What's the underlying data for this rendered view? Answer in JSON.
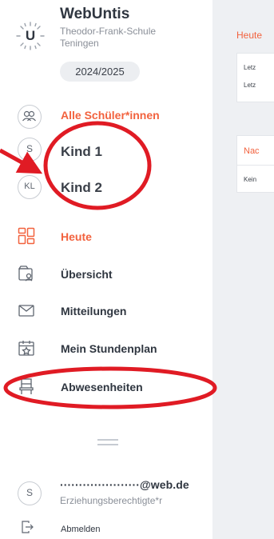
{
  "header": {
    "app_title": "WebUntis",
    "school_name": "Theodor-Frank-Schule",
    "school_city": "Teningen",
    "school_year": "2024/2025",
    "logo_letter": "U",
    "logo_icon": "webuntis-logo"
  },
  "students": {
    "all_label": "Alle Schüler*innen",
    "all_icon": "group-icon",
    "children": [
      {
        "initials": "S",
        "name": "Kind 1"
      },
      {
        "initials": "KL",
        "name": "Kind 2"
      }
    ]
  },
  "nav": [
    {
      "label": "Heute",
      "icon": "dashboard-icon",
      "active": true
    },
    {
      "label": "Übersicht",
      "icon": "overview-icon",
      "active": false
    },
    {
      "label": "Mitteilungen",
      "icon": "envelope-icon",
      "active": false
    },
    {
      "label": "Mein Stundenplan",
      "icon": "calendar-star-icon",
      "active": false
    },
    {
      "label": "Abwesenheiten",
      "icon": "chair-icon",
      "active": false
    }
  ],
  "user": {
    "initial": "S",
    "email": "·····················@web.de",
    "role": "Erziehungsberechtigte*r",
    "logout_label": "Abmelden",
    "logout_icon": "logout-icon"
  },
  "main": {
    "title": "Heute",
    "card1": {
      "line1": "Letz",
      "line2": "Letz"
    },
    "card2": {
      "heading": "Nac",
      "body": "Kein"
    }
  },
  "colors": {
    "accent": "#f2623e",
    "annotation": "#e01b24",
    "text": "#2f3640",
    "muted": "#8a8f98",
    "main_bg": "#eef0f3"
  }
}
